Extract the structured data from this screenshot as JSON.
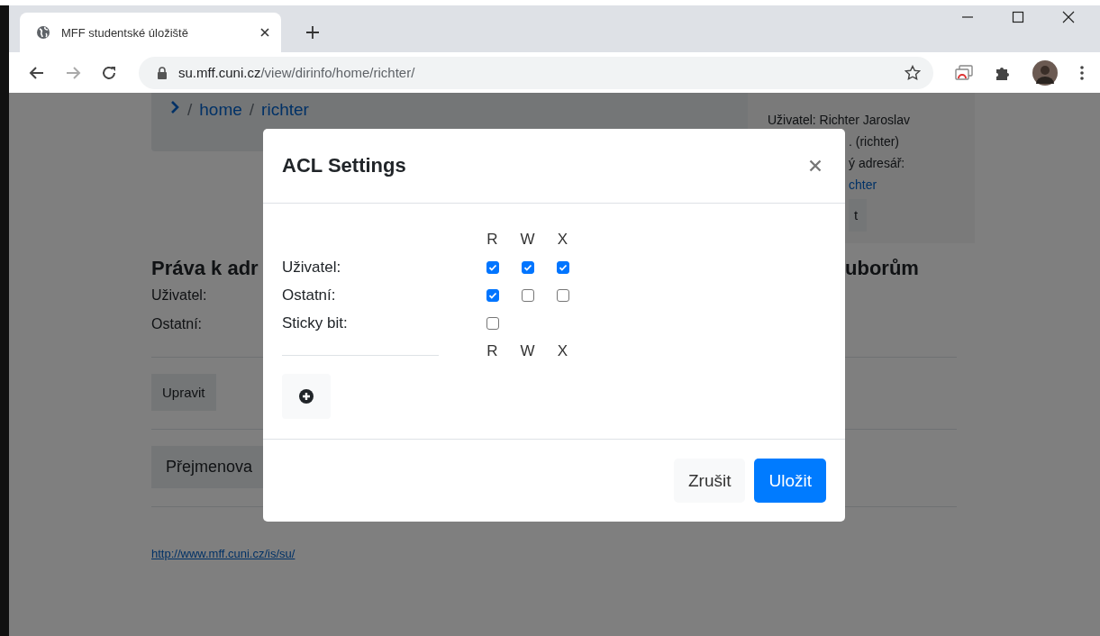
{
  "browser": {
    "tab": {
      "title": "MFF studentské úložiště"
    },
    "address": {
      "host": "su.mff.cuni.cz",
      "path": "/view/dirinfo/home/richter/"
    }
  },
  "page": {
    "breadcrumb": {
      "separator": "/",
      "items": [
        "home",
        "richter"
      ]
    },
    "user_panel": {
      "lines": [
        {
          "kind": "text",
          "text": "Uživatel: Richter Jaroslav"
        },
        {
          "kind": "text",
          "text": ". (richter)"
        },
        {
          "kind": "text",
          "text": "ý adresář:"
        },
        {
          "kind": "link",
          "text": "chter"
        },
        {
          "kind": "button",
          "text": "t"
        }
      ]
    },
    "permissions": {
      "heading": "Práva k adr",
      "labels": [
        "Uživatel:",
        "Ostatní:"
      ]
    },
    "files_heading": "uborům",
    "buttons": [
      "Upravit",
      "Přejmenova"
    ],
    "footer_link": "http://www.mff.cuni.cz/is/su/"
  },
  "modal": {
    "title": "ACL Settings",
    "columns": [
      "R",
      "W",
      "X"
    ],
    "rows": [
      {
        "label": "Uživatel:",
        "permissions": [
          {
            "checked": true
          },
          {
            "checked": true
          },
          {
            "checked": true
          }
        ]
      },
      {
        "label": "Ostatní:",
        "permissions": [
          {
            "checked": true
          },
          {
            "checked": false
          },
          {
            "checked": false
          }
        ]
      }
    ],
    "sticky": {
      "label": "Sticky bit:",
      "checked": false
    },
    "footer_columns": [
      "R",
      "W",
      "X"
    ],
    "buttons": [
      {
        "kind": "secondary",
        "label": "Zrušit"
      },
      {
        "kind": "primary",
        "label": "Uložit"
      }
    ]
  }
}
